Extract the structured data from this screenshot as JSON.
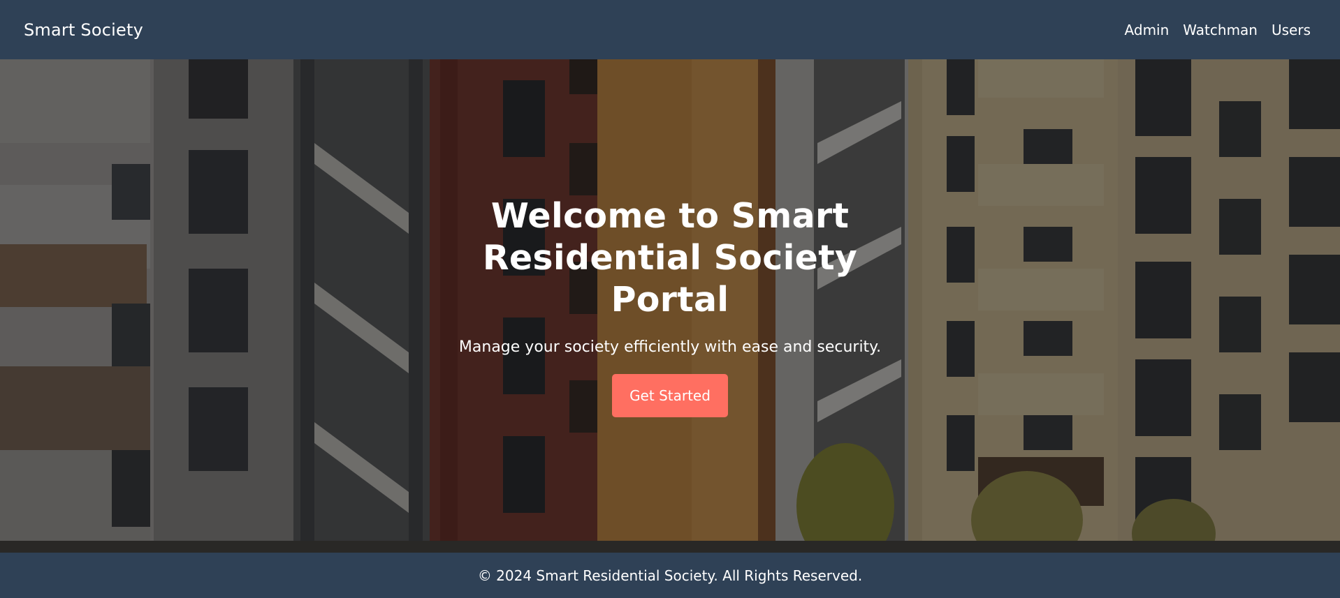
{
  "header": {
    "brand": "Smart Society",
    "nav": [
      {
        "label": "Admin"
      },
      {
        "label": "Watchman"
      },
      {
        "label": "Users"
      }
    ]
  },
  "hero": {
    "title": "Welcome to Smart Residential Society Portal",
    "subtitle": "Manage your society efficiently with ease and security.",
    "cta_label": "Get Started"
  },
  "footer": {
    "text": "© 2024 Smart Residential Society. All Rights Reserved."
  },
  "colors": {
    "header_bg": "#2f4156",
    "footer_bg": "#2f4156",
    "accent": "#ff6f61",
    "text": "#ffffff"
  }
}
